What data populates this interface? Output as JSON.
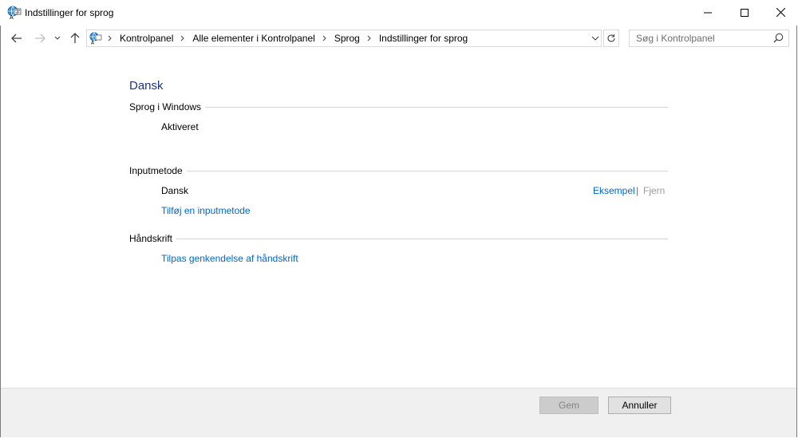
{
  "window": {
    "title": "Indstillinger for sprog",
    "icon": "language-settings-icon"
  },
  "address": {
    "breadcrumbs": [
      "Kontrolpanel",
      "Alle elementer i Kontrolpanel",
      "Sprog",
      "Indstillinger for sprog"
    ],
    "search_placeholder": "Søg i Kontrolpanel"
  },
  "content": {
    "language_name": "Dansk",
    "windows_language": {
      "heading": "Sprog i Windows",
      "status": "Aktiveret"
    },
    "input_method": {
      "heading": "Inputmetode",
      "method_name": "Dansk",
      "preview_link": "Eksempel",
      "separator": "|",
      "remove_link": "Fjern",
      "add_link": "Tilføj en inputmetode"
    },
    "handwriting": {
      "heading": "Håndskrift",
      "personalize_link": "Tilpas genkendelse af håndskrift"
    }
  },
  "footer": {
    "save_label": "Gem",
    "cancel_label": "Annuller"
  },
  "colors": {
    "heading_blue": "#1e3287",
    "link_blue": "#0066cc",
    "disabled_gray": "#9a9a9a"
  }
}
